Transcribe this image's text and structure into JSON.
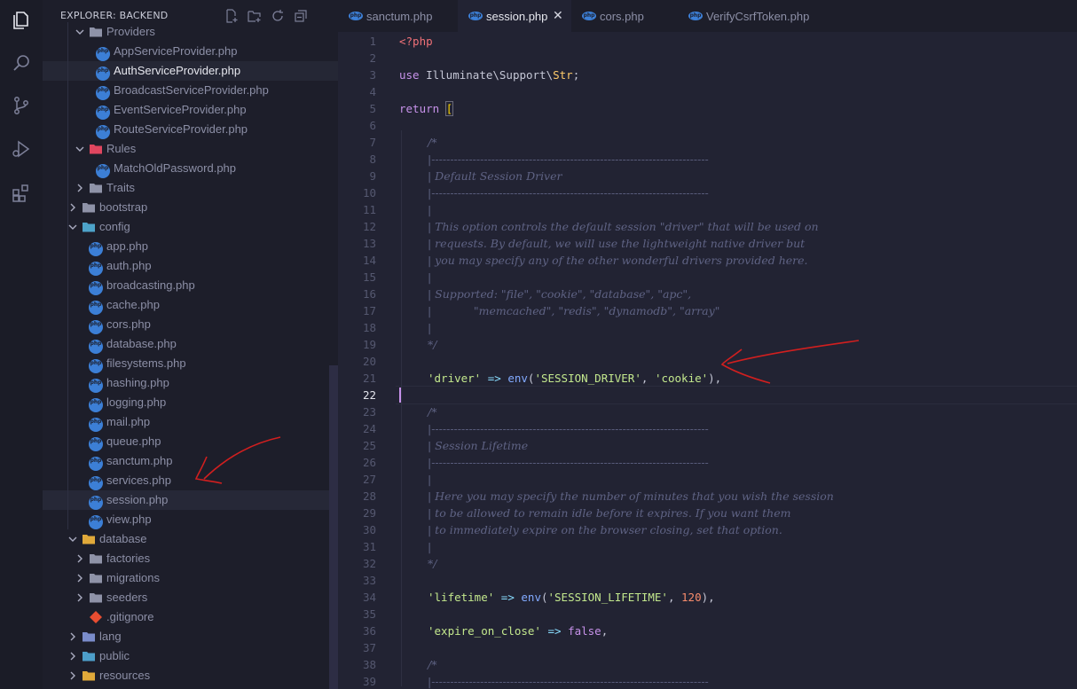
{
  "sidebar": {
    "title": "EXPLORER: BACKEND",
    "actions": [
      "new-file-icon",
      "new-folder-icon",
      "refresh-icon",
      "collapse-icon"
    ],
    "tree": [
      {
        "label": "Providers",
        "type": "folder",
        "depth": 2,
        "open": true
      },
      {
        "label": "AppServiceProvider.php",
        "type": "php",
        "depth": 3
      },
      {
        "label": "AuthServiceProvider.php",
        "type": "php",
        "depth": 3
      },
      {
        "label": "BroadcastServiceProvider.php",
        "type": "php",
        "depth": 3
      },
      {
        "label": "EventServiceProvider.php",
        "type": "php",
        "depth": 3
      },
      {
        "label": "RouteServiceProvider.php",
        "type": "php",
        "depth": 3
      },
      {
        "label": "Rules",
        "type": "folder-red",
        "depth": 2,
        "open": true
      },
      {
        "label": "MatchOldPassword.php",
        "type": "php",
        "depth": 3
      },
      {
        "label": "Traits",
        "type": "folder",
        "depth": 2,
        "open": false
      },
      {
        "label": "bootstrap",
        "type": "folder",
        "depth": 1,
        "open": false
      },
      {
        "label": "config",
        "type": "folder-config",
        "depth": 1,
        "open": true
      },
      {
        "label": "app.php",
        "type": "php",
        "depth": 2
      },
      {
        "label": "auth.php",
        "type": "php",
        "depth": 2
      },
      {
        "label": "broadcasting.php",
        "type": "php",
        "depth": 2
      },
      {
        "label": "cache.php",
        "type": "php",
        "depth": 2
      },
      {
        "label": "cors.php",
        "type": "php",
        "depth": 2
      },
      {
        "label": "database.php",
        "type": "php",
        "depth": 2
      },
      {
        "label": "filesystems.php",
        "type": "php",
        "depth": 2
      },
      {
        "label": "hashing.php",
        "type": "php",
        "depth": 2
      },
      {
        "label": "logging.php",
        "type": "php",
        "depth": 2
      },
      {
        "label": "mail.php",
        "type": "php",
        "depth": 2
      },
      {
        "label": "queue.php",
        "type": "php",
        "depth": 2
      },
      {
        "label": "sanctum.php",
        "type": "php",
        "depth": 2
      },
      {
        "label": "services.php",
        "type": "php",
        "depth": 2
      },
      {
        "label": "session.php",
        "type": "php",
        "depth": 2
      },
      {
        "label": "view.php",
        "type": "php",
        "depth": 2
      },
      {
        "label": "database",
        "type": "folder-db",
        "depth": 1,
        "open": true
      },
      {
        "label": "factories",
        "type": "folder",
        "depth": 2,
        "open": false
      },
      {
        "label": "migrations",
        "type": "folder",
        "depth": 2,
        "open": false
      },
      {
        "label": "seeders",
        "type": "folder",
        "depth": 2,
        "open": false
      },
      {
        "label": ".gitignore",
        "type": "git",
        "depth": 2
      },
      {
        "label": "lang",
        "type": "folder-lang",
        "depth": 1,
        "open": false
      },
      {
        "label": "public",
        "type": "folder-public",
        "depth": 1,
        "open": false
      },
      {
        "label": "resources",
        "type": "folder-res",
        "depth": 1,
        "open": false
      }
    ],
    "selected": "session.php",
    "active": "AuthServiceProvider.php"
  },
  "tabs": [
    {
      "label": "sanctum.php",
      "active": false
    },
    {
      "label": "session.php",
      "active": true,
      "close": "✕"
    },
    {
      "label": "cors.php",
      "active": false
    },
    {
      "label": "VerifyCsrfToken.php",
      "active": false
    }
  ],
  "editor": {
    "current_line": 22,
    "line_numbers": [
      "1",
      "2",
      "3",
      "4",
      "5",
      "6",
      "7",
      "8",
      "9",
      "10",
      "11",
      "12",
      "13",
      "14",
      "15",
      "16",
      "17",
      "18",
      "19",
      "20",
      "21",
      "22",
      "23",
      "24",
      "25",
      "26",
      "27",
      "28",
      "29",
      "30",
      "31",
      "32",
      "33",
      "34",
      "35",
      "36",
      "37",
      "38",
      "39"
    ],
    "comments": {
      "l7": "/*",
      "l8": "|--------------------------------------------------------------------------",
      "l9": "| Default Session Driver",
      "l10": "|--------------------------------------------------------------------------",
      "l11": "|",
      "l12": "| This option controls the default session \"driver\" that will be used on",
      "l13": "| requests. By default, we will use the lightweight native driver but",
      "l14": "| you may specify any of the other wonderful drivers provided here.",
      "l15": "|",
      "l16": "| Supported: \"file\", \"cookie\", \"database\", \"apc\",",
      "l17": "|            \"memcached\", \"redis\", \"dynamodb\", \"array\"",
      "l18": "|",
      "l19": "*/",
      "l23": "/*",
      "l24": "|--------------------------------------------------------------------------",
      "l25": "| Session Lifetime",
      "l26": "|--------------------------------------------------------------------------",
      "l27": "|",
      "l28": "| Here you may specify the number of minutes that you wish the session",
      "l29": "| to be allowed to remain idle before it expires. If you want them",
      "l30": "| to immediately expire on the browser closing, set that option.",
      "l31": "|",
      "l32": "*/",
      "l38": "/*",
      "l39": "|--------------------------------------------------------------------------"
    },
    "tokens": {
      "php_open": "<?php",
      "use_kw": "use",
      "use_path": "Illuminate\\Support\\",
      "use_class": "Str",
      "semicolon": ";",
      "return_kw": "return",
      "bracket": "[",
      "driver_key": "'driver'",
      "arrow": "=>",
      "env_fn": "env",
      "driver_env": "'SESSION_DRIVER'",
      "driver_default": "'cookie'",
      "lifetime_key": "'lifetime'",
      "lifetime_env": "'SESSION_LIFETIME'",
      "lifetime_default": "120",
      "expire_key": "'expire_on_close'",
      "expire_val": "false",
      "open_paren": "(",
      "close_paren_comma": "),",
      "comma": ",",
      "comma_sp": ", "
    }
  },
  "colors": {
    "annotation": "#d11f1f",
    "php_icon": "#3c7fd6"
  }
}
